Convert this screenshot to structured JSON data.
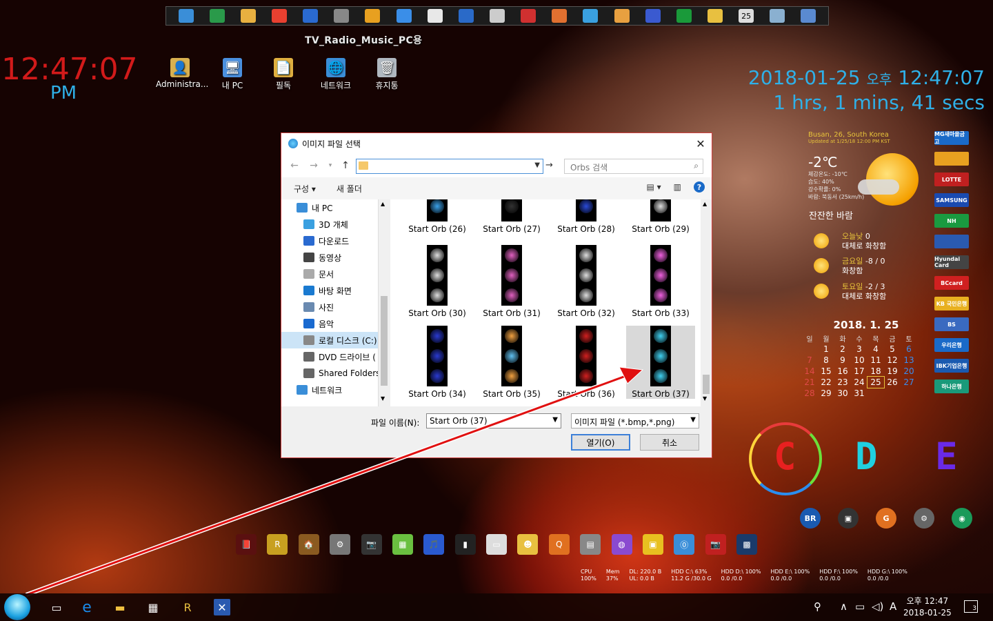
{
  "dock": {
    "icons": [
      "monitor-icon",
      "users-icon",
      "folder-icon",
      "chrome-icon",
      "ie-icon",
      "calendar-icon",
      "avast-icon",
      "drive-icon",
      "nc-icon",
      "aimp-icon",
      "tag-icon",
      "pen-icon",
      "calc-icon",
      "globe-icon",
      "eye-icon",
      "floppy-icon",
      "u-icon",
      "pencil-icon",
      "calendar25-icon",
      "drop-icon",
      "gear-icon"
    ],
    "calendar_day": "25"
  },
  "desktop": {
    "tv_label": "TV_Radio_Music_PC용",
    "clock_time": "12:47:07",
    "clock_ampm": "PM",
    "icons": [
      {
        "label": "Administra...",
        "color": "#d8b050",
        "glyph": "👤"
      },
      {
        "label": "내 PC",
        "color": "#4a90e0",
        "glyph": "🖥"
      },
      {
        "label": "필독",
        "color": "#e0b040",
        "glyph": "📄"
      },
      {
        "label": "네트워크",
        "color": "#3a8ed8",
        "glyph": "🌐"
      },
      {
        "label": "휴지통",
        "color": "#b0b8c0",
        "glyph": "🗑"
      }
    ]
  },
  "right_clock": {
    "date": "2018-01-25",
    "ampm": "오후",
    "time": "12:47:07",
    "uptime": "1 hrs, 1 mins, 41 secs"
  },
  "weather": {
    "location": "Busan, 26, South Korea",
    "updated": "Updated at 1/25/18 12:00 PM KST",
    "temp": "-2℃",
    "details": [
      "체감온도: -10℃",
      "습도: 40%",
      "강수확률: 0%",
      "바람: 북동서 (25km/h)"
    ],
    "wind_desc": "잔잔한 바람",
    "forecast": [
      {
        "day": "오늘낮",
        "temps": "0",
        "desc": "대체로 화창함"
      },
      {
        "day": "금요일",
        "temps": "-8 / 0",
        "desc": "화창함"
      },
      {
        "day": "토요일",
        "temps": "-2 / 3",
        "desc": "대체로 화창함"
      }
    ]
  },
  "calendar": {
    "title": "2018. 1.  25",
    "headers": [
      "일",
      "월",
      "화",
      "수",
      "목",
      "금",
      "토"
    ],
    "weeks": [
      [
        "",
        "1",
        "2",
        "3",
        "4",
        "5",
        "6"
      ],
      [
        "7",
        "8",
        "9",
        "10",
        "11",
        "12",
        "13"
      ],
      [
        "14",
        "15",
        "16",
        "17",
        "18",
        "19",
        "20"
      ],
      [
        "21",
        "22",
        "23",
        "24",
        "25",
        "26",
        "27"
      ],
      [
        "28",
        "29",
        "30",
        "31",
        "",
        "",
        ""
      ]
    ],
    "today": "25"
  },
  "banks": [
    {
      "label": "MG새마을금고",
      "color": "#1a6ac8"
    },
    {
      "label": "",
      "color": "#e8a020"
    },
    {
      "label": "LOTTE",
      "color": "#c02020"
    },
    {
      "label": "SAMSUNG",
      "color": "#1a4ab0"
    },
    {
      "label": "NH",
      "color": "#1a9a40"
    },
    {
      "label": "",
      "color": "#2a5ab0"
    },
    {
      "label": "Hyundai Card",
      "color": "#444"
    },
    {
      "label": "BCcard",
      "color": "#d02020"
    },
    {
      "label": "KB 국민은행",
      "color": "#e8b020"
    },
    {
      "label": "BS",
      "color": "#3a6ac0"
    },
    {
      "label": "우리은행",
      "color": "#1a6ac8"
    },
    {
      "label": "IBK기업은행",
      "color": "#1a5ab0"
    },
    {
      "label": "하나은행",
      "color": "#1a9a7a"
    }
  ],
  "drives": {
    "c": "C",
    "d": "D",
    "e": "E",
    "c_color": "#e82020",
    "d_color": "#20d0e0",
    "e_color": "#6a2ae8"
  },
  "row_icons": [
    {
      "label": "BR",
      "color": "#1a5ab0"
    },
    {
      "label": "▣",
      "color": "#333"
    },
    {
      "label": "G",
      "color": "#e07020"
    },
    {
      "label": "⚙",
      "color": "#666"
    },
    {
      "label": "◉",
      "color": "#1a9a5a"
    }
  ],
  "mid_icons": [
    "📕",
    "R",
    "🏠",
    "⚙",
    "📷",
    "▦",
    "🎵",
    "▮",
    "▭",
    "☻",
    "Q",
    "▤",
    "◍",
    "▣",
    "⓪",
    "📷",
    "▩"
  ],
  "meters": [
    {
      "l1": "CPU",
      "l2": "100%"
    },
    {
      "l1": "Mem",
      "l2": "37%"
    },
    {
      "l1": "DL:  220.0 B",
      "l2": "UL:    0.0 B"
    },
    {
      "l1": "HDD C:\\   63%",
      "l2": "11.2 G  /30.0 G"
    },
    {
      "l1": "HDD D:\\  100%",
      "l2": "0.0      /0.0"
    },
    {
      "l1": "HDD E:\\  100%",
      "l2": "0.0      /0.0"
    },
    {
      "l1": "HDD F:\\  100%",
      "l2": "0.0      /0.0"
    },
    {
      "l1": "HDD G:\\  100%",
      "l2": "0.0      /0.0"
    }
  ],
  "dialog": {
    "title": "이미지 파일 선택",
    "search_placeholder": "Orbs 검색",
    "cmd_organize": "구성 ▾",
    "cmd_newfolder": "새 폴더",
    "tree": [
      {
        "label": "내 PC",
        "color": "#3a8ed8",
        "indent": 22
      },
      {
        "label": "3D 개체",
        "color": "#3aa0e0",
        "indent": 32
      },
      {
        "label": "다운로드",
        "color": "#2a6ad0",
        "indent": 32
      },
      {
        "label": "동영상",
        "color": "#444",
        "indent": 32
      },
      {
        "label": "문서",
        "color": "#aaa",
        "indent": 32
      },
      {
        "label": "바탕 화면",
        "color": "#1a7ad0",
        "indent": 32
      },
      {
        "label": "사진",
        "color": "#6a8ab0",
        "indent": 32
      },
      {
        "label": "음악",
        "color": "#1a6ad0",
        "indent": 32
      },
      {
        "label": "로컬 디스크 (C:)",
        "color": "#888",
        "indent": 32
      },
      {
        "label": "DVD 드라이브 (",
        "color": "#666",
        "indent": 32
      },
      {
        "label": "Shared Folders(\\",
        "color": "#666",
        "indent": 32
      },
      {
        "label": "네트워크",
        "color": "#3a8ed8",
        "indent": 22
      }
    ],
    "files": [
      {
        "label": "Start Orb (26)",
        "c": [
          "#e87020",
          "#3aa0e8"
        ]
      },
      {
        "label": "Start Orb (27)",
        "c": [
          "#888",
          "#333"
        ]
      },
      {
        "label": "Start Orb (28)",
        "c": [
          "#2a4ad8",
          "#2a4ad8"
        ]
      },
      {
        "label": "Start Orb (29)",
        "c": [
          "#ddd",
          "#ddd"
        ]
      },
      {
        "label": "Start Orb (30)",
        "c": [
          "#ddd",
          "#ddd",
          "#ddd"
        ]
      },
      {
        "label": "Start Orb (31)",
        "c": [
          "#e060c0",
          "#e060c0",
          "#e060c0"
        ]
      },
      {
        "label": "Start Orb (32)",
        "c": [
          "#ddd",
          "#ddd",
          "#ddd"
        ]
      },
      {
        "label": "Start Orb (33)",
        "c": [
          "#f060e0",
          "#f060e0",
          "#f060e0"
        ]
      },
      {
        "label": "Start Orb (34)",
        "c": [
          "#2a3ad0",
          "#2a3ad0",
          "#2a3ad0"
        ]
      },
      {
        "label": "Start Orb (35)",
        "c": [
          "#f0a040",
          "#60c0f0",
          "#f0a040"
        ]
      },
      {
        "label": "Start Orb (36)",
        "c": [
          "#d02020",
          "#d02020",
          "#d02020"
        ]
      },
      {
        "label": "Start Orb (37)",
        "c": [
          "#40d0f0",
          "#40d0f0",
          "#40d0f0"
        ]
      }
    ],
    "filename_label": "파일 이름(N):",
    "filename_value": "Start Orb (37)",
    "filetype": "이미지 파일 (*.bmp,*.png)",
    "open_label": "열기(O)",
    "cancel_label": "취소"
  },
  "taskbar": {
    "clock_ampm_time": "오후 12:47",
    "date": "2018-01-25",
    "ime": "A",
    "notif_count": "3"
  }
}
